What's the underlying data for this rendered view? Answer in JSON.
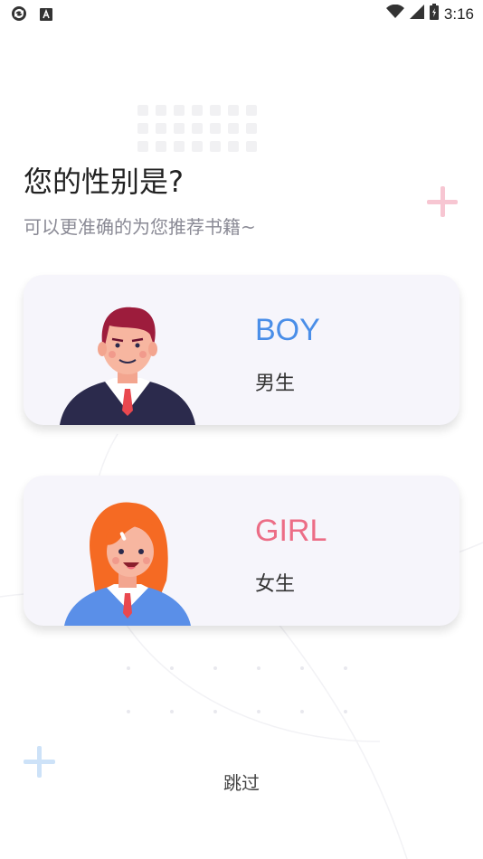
{
  "status_bar": {
    "time": "3:16",
    "icons": [
      "sync-icon",
      "a-icon",
      "wifi-icon",
      "signal-icon",
      "battery-icon"
    ]
  },
  "header": {
    "title": "您的性别是?",
    "subtitle": "可以更准确的为您推荐书籍~"
  },
  "options": [
    {
      "en": "BOY",
      "cn": "男生",
      "color": "#4a8ee8"
    },
    {
      "en": "GIRL",
      "cn": "女生",
      "color": "#ec6d86"
    }
  ],
  "skip_label": "跳过"
}
